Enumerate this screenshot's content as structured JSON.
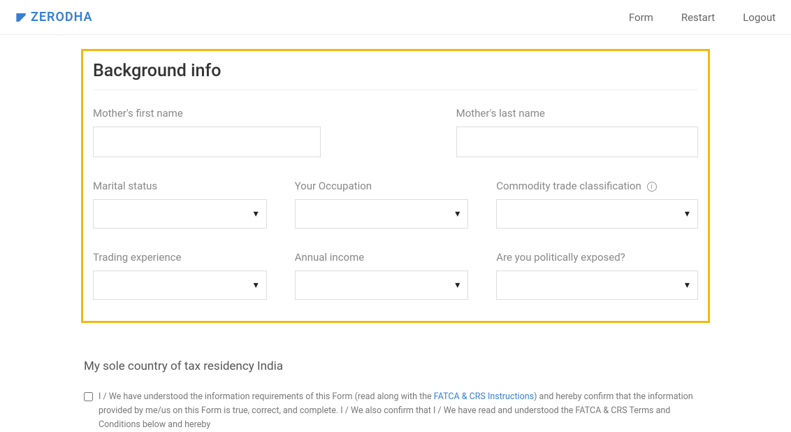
{
  "header": {
    "brand_name": "ZERODHA",
    "nav": {
      "form": "Form",
      "restart": "Restart",
      "logout": "Logout"
    }
  },
  "section": {
    "title": "Background info",
    "fields": {
      "mothers_first_name_label": "Mother's first name",
      "mothers_last_name_label": "Mother's last name",
      "marital_status_label": "Marital status",
      "occupation_label": "Your Occupation",
      "commodity_label": "Commodity trade classification",
      "trading_exp_label": "Trading experience",
      "annual_income_label": "Annual income",
      "pep_label": "Are you politically exposed?"
    }
  },
  "tax": {
    "title": "My sole country of tax residency India",
    "consent_prefix": "I / We have understood the information requirements of this Form (read along with the ",
    "consent_link": "FATCA & CRS Instructions",
    "consent_suffix": ") and hereby confirm that the information provided by me/us on this Form is true, correct, and complete. I / We also confirm that I / We have read and understood the FATCA & CRS Terms and Conditions below and hereby"
  }
}
